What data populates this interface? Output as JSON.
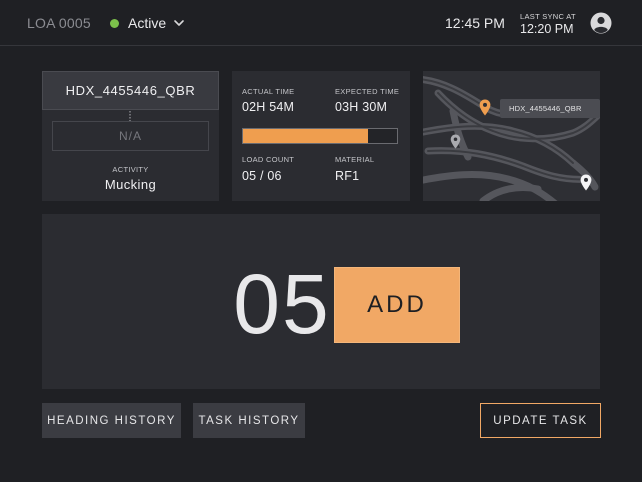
{
  "header": {
    "loa_id": "LOA 0005",
    "status": "Active",
    "status_color": "#7cc04b",
    "clock": "12:45 PM",
    "last_sync_label": "LAST SYNC AT",
    "last_sync_time": "12:20 PM"
  },
  "equipment": {
    "id": "HDX_4455446_QBR",
    "secondary": "N/A",
    "activity_label": "ACTIVITY",
    "activity_value": "Mucking"
  },
  "times": {
    "actual_label": "ACTUAL TIME",
    "actual_value": "02H 54M",
    "expected_label": "EXPECTED TIME",
    "expected_value": "03H 30M",
    "progress": 0.81,
    "progress_color": "#ef9e4f",
    "load_count_label": "LOAD COUNT",
    "load_count_value": "05 / 06",
    "material_label": "MATERIAL",
    "material_value": "RF1"
  },
  "map": {
    "marker_label": "HDX_4455446_QBR",
    "marker_color": "#ef9e4f"
  },
  "counter": {
    "value": "05",
    "add_label": "ADD",
    "accent_color": "#f1a865"
  },
  "actions": {
    "heading_history": "HEADING HISTORY",
    "task_history": "TASK HISTORY",
    "update_task": "UPDATE TASK"
  }
}
